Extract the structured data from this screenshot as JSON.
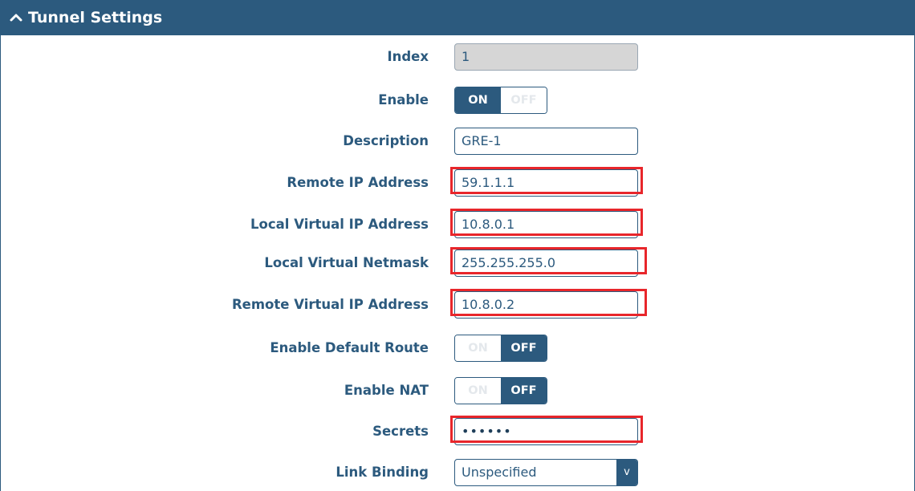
{
  "header": {
    "title": "Tunnel Settings",
    "collapse_icon": "chevron-up-icon"
  },
  "fields": {
    "index": {
      "label": "Index",
      "value": "1"
    },
    "enable": {
      "label": "Enable",
      "on_label": "ON",
      "off_label": "OFF",
      "state": "on"
    },
    "description": {
      "label": "Description",
      "value": "GRE-1"
    },
    "remote_ip": {
      "label": "Remote IP Address",
      "value": "59.1.1.1"
    },
    "local_virtual_ip": {
      "label": "Local Virtual IP Address",
      "value": "10.8.0.1"
    },
    "local_virtual_netmask": {
      "label": "Local Virtual Netmask",
      "value": "255.255.255.0"
    },
    "remote_virtual_ip": {
      "label": "Remote Virtual IP Address",
      "value": "10.8.0.2"
    },
    "default_route": {
      "label": "Enable Default Route",
      "on_label": "ON",
      "off_label": "OFF",
      "state": "off"
    },
    "nat": {
      "label": "Enable NAT",
      "on_label": "ON",
      "off_label": "OFF",
      "state": "off"
    },
    "secrets": {
      "label": "Secrets",
      "value": "••••••"
    },
    "link_binding": {
      "label": "Link Binding",
      "value": "Unspecified",
      "arrow": "v"
    }
  },
  "colors": {
    "primary": "#2c5a7e",
    "highlight": "#e8262b",
    "disabled_bg": "#d6d6d6"
  }
}
